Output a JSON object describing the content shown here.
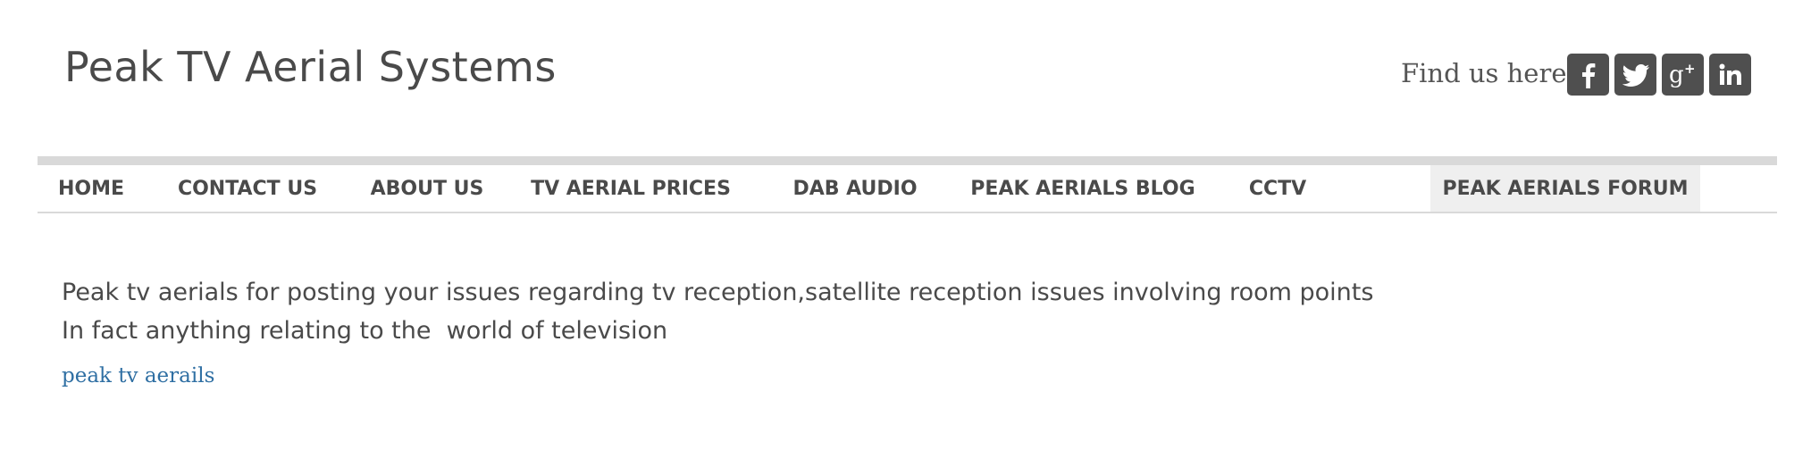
{
  "header": {
    "site_title": "Peak TV Aerial Systems",
    "find_us": "Find us here",
    "social": [
      {
        "icon": "facebook-icon",
        "glyph": "f"
      },
      {
        "icon": "twitter-icon",
        "glyph": "t"
      },
      {
        "icon": "google-plus-icon",
        "glyph": "g+"
      },
      {
        "icon": "linkedin-icon",
        "glyph": "in"
      }
    ]
  },
  "nav": {
    "items": [
      {
        "label": "HOME"
      },
      {
        "label": "CONTACT US"
      },
      {
        "label": "ABOUT US"
      },
      {
        "label": "TV AERIAL PRICES"
      },
      {
        "label": "DAB AUDIO"
      },
      {
        "label": "PEAK AERIALS BLOG"
      },
      {
        "label": "CCTV"
      },
      {
        "label": "PEAK AERIALS FORUM",
        "active": true
      }
    ]
  },
  "main": {
    "line1": "Peak tv aerials for posting your issues regarding tv reception,satellite reception issues involving room points",
    "line2": "In fact anything relating to the  world of television",
    "link": "peak tv aerails"
  },
  "colors": {
    "text": "#4a4a4a",
    "social_bg": "#4f4f4f",
    "nav_bar": "#d9d9d9",
    "active_tab_bg": "#efefef",
    "link": "#2f6fa3"
  }
}
